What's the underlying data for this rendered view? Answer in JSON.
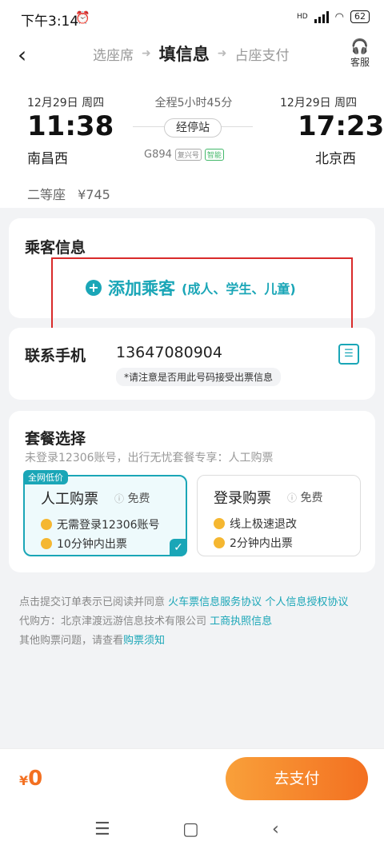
{
  "status_bar": {
    "time": "下午3:14",
    "battery": "62"
  },
  "nav_header": {
    "steps": [
      "选座席",
      "填信息",
      "占座支付"
    ],
    "service_label": "客服"
  },
  "trip": {
    "depart_date": "12月29日 周四",
    "depart_time": "11:38",
    "depart_station": "南昌西",
    "duration": "全程5小时45分",
    "stop_label": "经停站",
    "train_no": "G894",
    "train_tags": [
      "复兴号",
      "智能"
    ],
    "arrive_date": "12月29日 周四",
    "arrive_time": "17:23",
    "arrive_station": "北京西",
    "seat_class": "二等座",
    "seat_price": "¥745"
  },
  "passenger": {
    "title": "乘客信息",
    "add_label": "添加乘客",
    "add_sub": "(成人、学生、儿童)"
  },
  "contact": {
    "label": "联系手机",
    "phone": "13647080904",
    "note": "*请注意是否用此号码接受出票信息"
  },
  "package": {
    "title": "套餐选择",
    "subtitle": "未登录12306账号，出行无忧套餐专享：人工购票",
    "options": [
      {
        "badge": "全网低价",
        "name": "人工购票",
        "price": "免费",
        "lines": [
          "无需登录12306账号",
          "10分钟内出票"
        ],
        "selected": true
      },
      {
        "name": "登录购票",
        "price": "免费",
        "lines": [
          "线上极速退改",
          "2分钟内出票"
        ],
        "selected": false
      }
    ]
  },
  "agreement": {
    "line1_text": "点击提交订单表示已阅读并同意",
    "link1": "火车票信息服务协议",
    "link2": "个人信息授权协议",
    "line2_text": "代购方：北京津渡远游信息技术有限公司",
    "link3": "工商执照信息",
    "line3_text": "其他购票问题，请查看",
    "link4": "购票须知"
  },
  "bottom_bar": {
    "currency": "¥",
    "amount": "0",
    "pay_label": "去支付"
  },
  "colors": {
    "accent": "#1aa6b7",
    "pay": "#f37021",
    "highlight": "#d92b2b"
  }
}
